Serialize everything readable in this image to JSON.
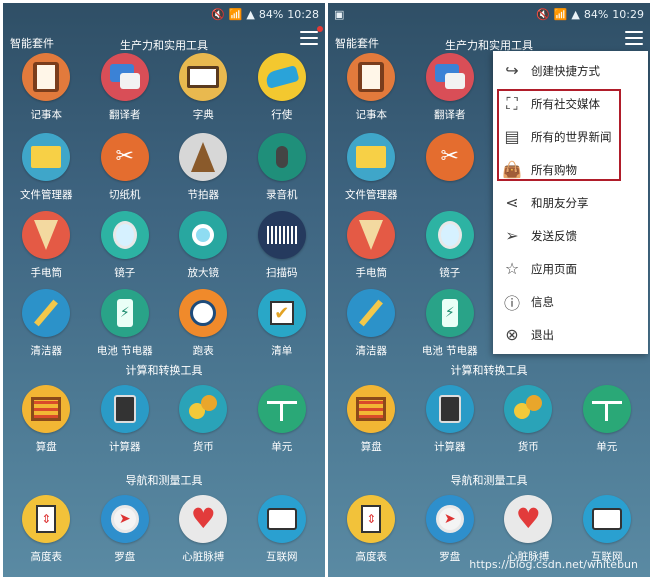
{
  "left": {
    "status": {
      "mute": "🔇",
      "wifi": "📶",
      "signal": "▲",
      "battery": "84%",
      "time": "10:28"
    },
    "app_title": "智能套件",
    "section1": "生产力和实用工具",
    "section2": "计算和转换工具",
    "section3": "导航和测量工具"
  },
  "right": {
    "status": {
      "gallery": "▣",
      "mute": "🔇",
      "wifi": "📶",
      "signal": "▲",
      "battery": "84%",
      "time": "10:29"
    },
    "app_title": "智能套件",
    "section1": "生产力和实用工具",
    "section2": "计算和转换工具",
    "section3": "导航和测量工具"
  },
  "tiles": {
    "row1": [
      "记事本",
      "翻译者",
      "字典",
      "行使"
    ],
    "row2": [
      "文件管理器",
      "切纸机",
      "节拍器",
      "录音机"
    ],
    "row3": [
      "手电筒",
      "镜子",
      "放大镜",
      "扫描码"
    ],
    "row4": [
      "清洁器",
      "电池 节电器",
      "跑表",
      "清单"
    ],
    "row5": [
      "算盘",
      "计算器",
      "货币",
      "单元"
    ],
    "row6": [
      "高度表",
      "罗盘",
      "心脏脉搏",
      "互联网"
    ]
  },
  "right_visible_tiles": {
    "row1": [
      "记事本",
      "翻译者"
    ],
    "row2": [
      "文件管理器"
    ],
    "row3": [
      "手电筒",
      "镜子"
    ],
    "row4": [
      "清洁器",
      "电池 节电器"
    ],
    "row5": [
      "算盘",
      "计算器",
      "货币",
      "单元"
    ],
    "row6": [
      "高度表",
      "罗盘",
      "心脏脉搏",
      "互联网"
    ]
  },
  "popup_menu": [
    {
      "label": "创建快捷方式",
      "icon": "share-arrow-icon"
    },
    {
      "label": "所有社交媒体",
      "icon": "frame-icon"
    },
    {
      "label": "所有的世界新闻",
      "icon": "newspaper-icon"
    },
    {
      "label": "所有购物",
      "icon": "shopping-bag-icon"
    },
    {
      "label": "和朋友分享",
      "icon": "share-icon"
    },
    {
      "label": "发送反馈",
      "icon": "send-icon"
    },
    {
      "label": "应用页面",
      "icon": "star-icon"
    },
    {
      "label": "信息",
      "icon": "info-icon"
    },
    {
      "label": "退出",
      "icon": "close-circle-icon"
    }
  ],
  "watermark": "https://blog.csdn.net/whitebun",
  "colors": {
    "highlight": "#b01d2a",
    "notification_dot": "#e53935",
    "background": "#3e6480"
  }
}
